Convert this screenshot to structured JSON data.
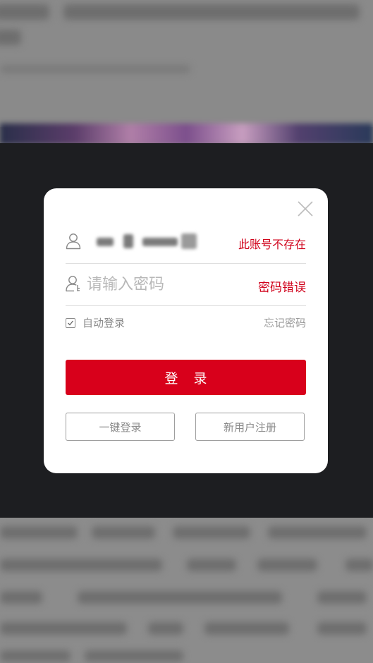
{
  "login_modal": {
    "username": {
      "icon": "user-icon",
      "value_obscured": true,
      "error_message": "此账号不存在"
    },
    "password": {
      "icon": "user-key-icon",
      "placeholder": "请输入密码",
      "error_message": "密码错误"
    },
    "auto_login": {
      "label": "自动登录",
      "checked": true
    },
    "forgot_password_label": "忘记密码",
    "login_button_label": "登录",
    "one_click_login_label": "一键登录",
    "register_label": "新用户注册",
    "close_icon": "close-icon"
  },
  "colors": {
    "accent_red": "#d8001b",
    "error_text": "#d0021b",
    "overlay": "#1d1e21"
  }
}
